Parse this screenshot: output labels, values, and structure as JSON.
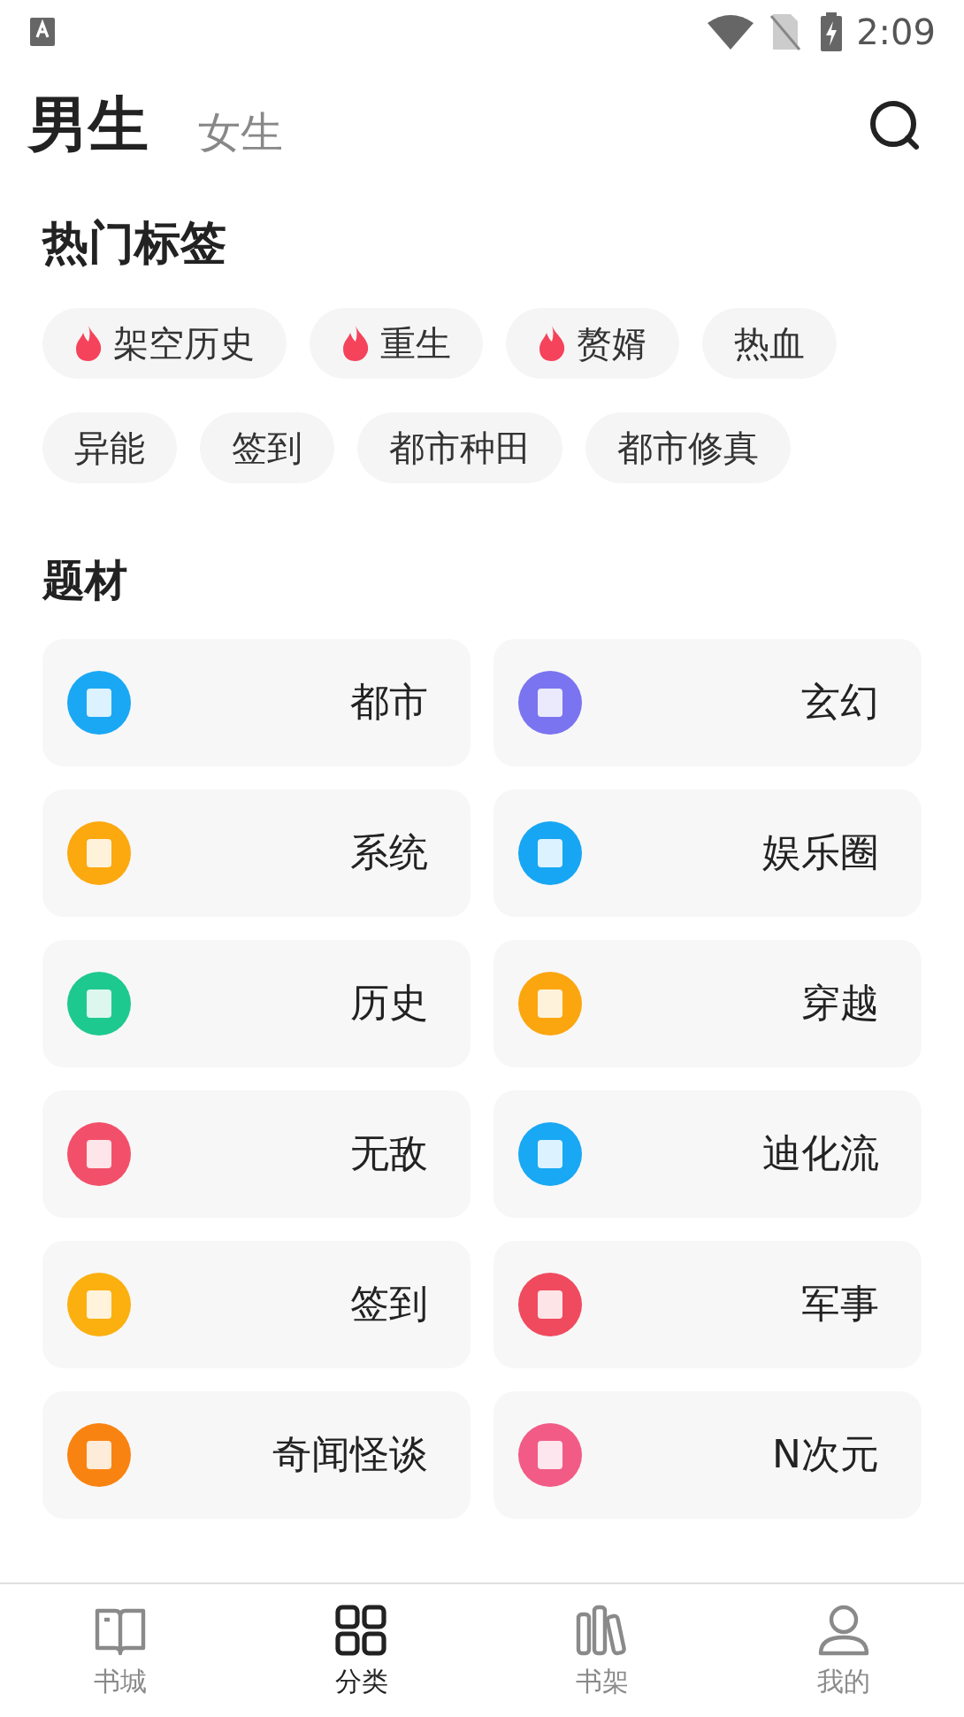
{
  "status_bar": {
    "time": "2:09"
  },
  "header": {
    "tabs": [
      {
        "label": "男生",
        "selected": true
      },
      {
        "label": "女生",
        "selected": false
      }
    ]
  },
  "hot_tags": {
    "title": "热门标签",
    "tags": [
      {
        "label": "架空历史",
        "hot": true
      },
      {
        "label": "重生",
        "hot": true
      },
      {
        "label": "赘婿",
        "hot": true
      },
      {
        "label": "热血",
        "hot": false
      },
      {
        "label": "异能",
        "hot": false
      },
      {
        "label": "签到",
        "hot": false
      },
      {
        "label": "都市种田",
        "hot": false
      },
      {
        "label": "都市修真",
        "hot": false
      }
    ]
  },
  "genres": {
    "title": "题材",
    "items": [
      {
        "label": "都市",
        "color": "#1aa8f5"
      },
      {
        "label": "玄幻",
        "color": "#7a74f0"
      },
      {
        "label": "系统",
        "color": "#fca80f"
      },
      {
        "label": "娱乐圈",
        "color": "#17a6f3"
      },
      {
        "label": "历史",
        "color": "#1ec98f"
      },
      {
        "label": "穿越",
        "color": "#fba60f"
      },
      {
        "label": "无敌",
        "color": "#f2506a"
      },
      {
        "label": "迪化流",
        "color": "#18a8f4"
      },
      {
        "label": "签到",
        "color": "#fbb010"
      },
      {
        "label": "军事",
        "color": "#f04a5e"
      },
      {
        "label": "奇闻怪谈",
        "color": "#f98310"
      },
      {
        "label": "N次元",
        "color": "#f25b86"
      }
    ]
  },
  "bottom_nav": [
    {
      "label": "书城",
      "kind": "book",
      "selected": false
    },
    {
      "label": "分类",
      "kind": "grid",
      "selected": true
    },
    {
      "label": "书架",
      "kind": "shelf",
      "selected": false
    },
    {
      "label": "我的",
      "kind": "person",
      "selected": false
    }
  ]
}
